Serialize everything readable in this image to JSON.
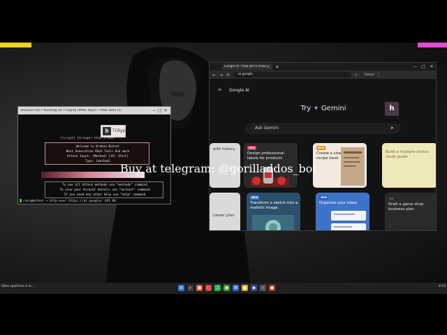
{
  "terminal": {
    "title": "Sessions (0) • Running (0) • Expiry (9991 days) • Max Slots (1)",
    "logo_text": "TCRyp",
    "logo_caption": "[tcrypt] Stronger than a ddos ...",
    "menu_lines": [
      "Welcome to Kraken Botnet",
      "Next Generation DDoS Tools And more",
      "Attack Input: [Method] [IP] [Port]",
      "Type: [method]"
    ],
    "hint_lines": [
      "To see all Attack methods use \"methods\" command",
      "To view your Account details use \"account\" command",
      "If you need any other help use \"help\" command"
    ],
    "prompt": "root@botnet ➡ http-ever https://ai.google/ 443 60"
  },
  "browser": {
    "tab_title": "Google AI - How we're making",
    "url": "ai.google",
    "extra_label": "Extras",
    "brand": "Google AI",
    "avatar_letter": "h",
    "try_label": "Try",
    "gemini_label": "Gemini",
    "search_placeholder": "Ask Gemini",
    "cards": [
      {
        "badge": "",
        "title": "with history"
      },
      {
        "badge": "NEW",
        "title": "Design professional labels for products"
      },
      {
        "badge": "NEW",
        "title": "Create a shareable family recipe book"
      },
      {
        "badge": "",
        "title": "Build a multiple-choice study guide"
      },
      {
        "badge": "",
        "title": "career plan"
      },
      {
        "badge": "NEW",
        "title": "Transform a sketch into a realistic image"
      },
      {
        "badge": "NEW",
        "title": "Organize your inbox"
      },
      {
        "badge": "",
        "title": "Draft a game shop business plan"
      }
    ]
  },
  "watermark": "Buy at telegram: @gorilladdos_bot",
  "taskbar": {
    "left_text": "Sites sportives à la...",
    "right_text": "4:53"
  },
  "colors": {
    "accent_yellow": "#f2d21b",
    "accent_pink": "#e24bd6",
    "accent_orange": "#f07c1d",
    "accent_purple": "#9b5be0"
  }
}
